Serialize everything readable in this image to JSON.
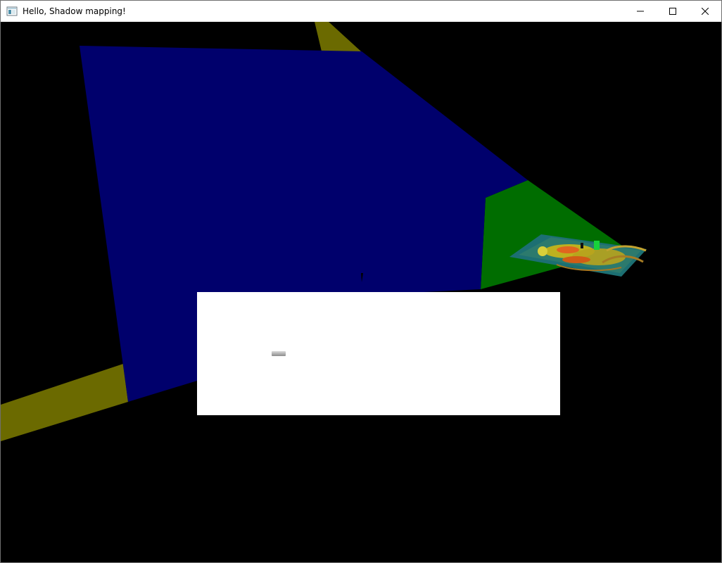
{
  "window": {
    "title": "Hello, Shadow mapping!",
    "icon": "app-window-icon",
    "controls": {
      "minimize_icon": "minimize-icon",
      "maximize_icon": "maximize-icon",
      "close_icon": "close-icon"
    }
  },
  "scene": {
    "background": "#000000",
    "colors": {
      "blue_plane": "#00006c",
      "green_plane": "#006d00",
      "yellow_beam": "#6b6a00",
      "teal_floor": "#1c6f72",
      "yellow_object": "#bdb11e",
      "orange_object": "#d25c16",
      "bright_green": "#17d23a"
    }
  },
  "debug_panel": {
    "background": "#ffffff",
    "slider_icon": "slider-knob"
  }
}
